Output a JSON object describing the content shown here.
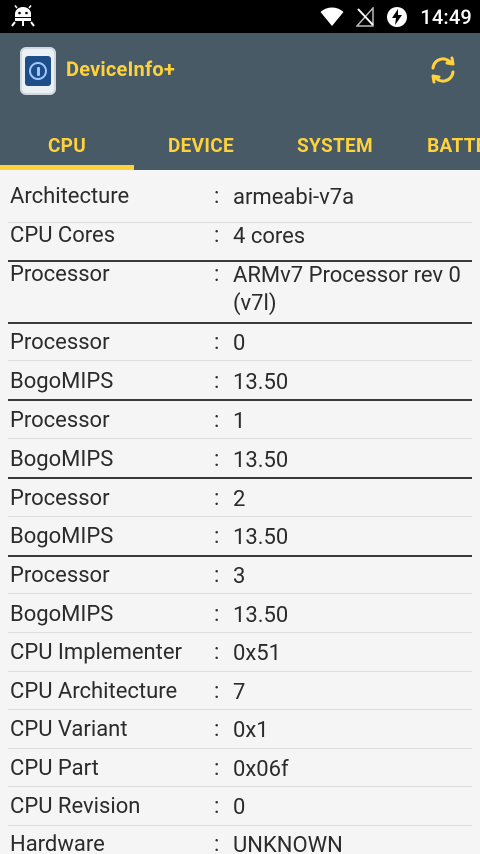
{
  "status_bar": {
    "time": "14:49",
    "icons": [
      "android-debug-icon",
      "wifi-icon",
      "no-signal-icon",
      "battery-charging-icon"
    ]
  },
  "app": {
    "title": "DeviceInfo+",
    "colors": {
      "toolbar": "#475a66",
      "accent": "#ffd23c"
    }
  },
  "tabs": [
    {
      "label": "CPU",
      "active": true
    },
    {
      "label": "DEVICE",
      "active": false
    },
    {
      "label": "SYSTEM",
      "active": false
    },
    {
      "label": "BATTERY",
      "active": false
    }
  ],
  "rows": [
    {
      "label": "Architecture",
      "value": "armeabi-v7a"
    },
    {
      "label": "CPU Cores",
      "value": "4 cores"
    },
    {
      "label": "Processor",
      "value": "ARMv7 Processor rev 0 (v7l)"
    },
    {
      "label": "Processor",
      "value": "0"
    },
    {
      "label": "BogoMIPS",
      "value": "13.50"
    },
    {
      "label": "Processor",
      "value": "1"
    },
    {
      "label": "BogoMIPS",
      "value": "13.50"
    },
    {
      "label": "Processor",
      "value": "2"
    },
    {
      "label": "BogoMIPS",
      "value": "13.50"
    },
    {
      "label": "Processor",
      "value": "3"
    },
    {
      "label": "BogoMIPS",
      "value": "13.50"
    },
    {
      "label": "CPU Implementer",
      "value": "0x51"
    },
    {
      "label": "CPU Architecture",
      "value": "7"
    },
    {
      "label": "CPU Variant",
      "value": "0x1"
    },
    {
      "label": "CPU Part",
      "value": "0x06f"
    },
    {
      "label": "CPU Revision",
      "value": "0"
    },
    {
      "label": "Hardware",
      "value": "UNKNOWN"
    }
  ],
  "separator": ":"
}
